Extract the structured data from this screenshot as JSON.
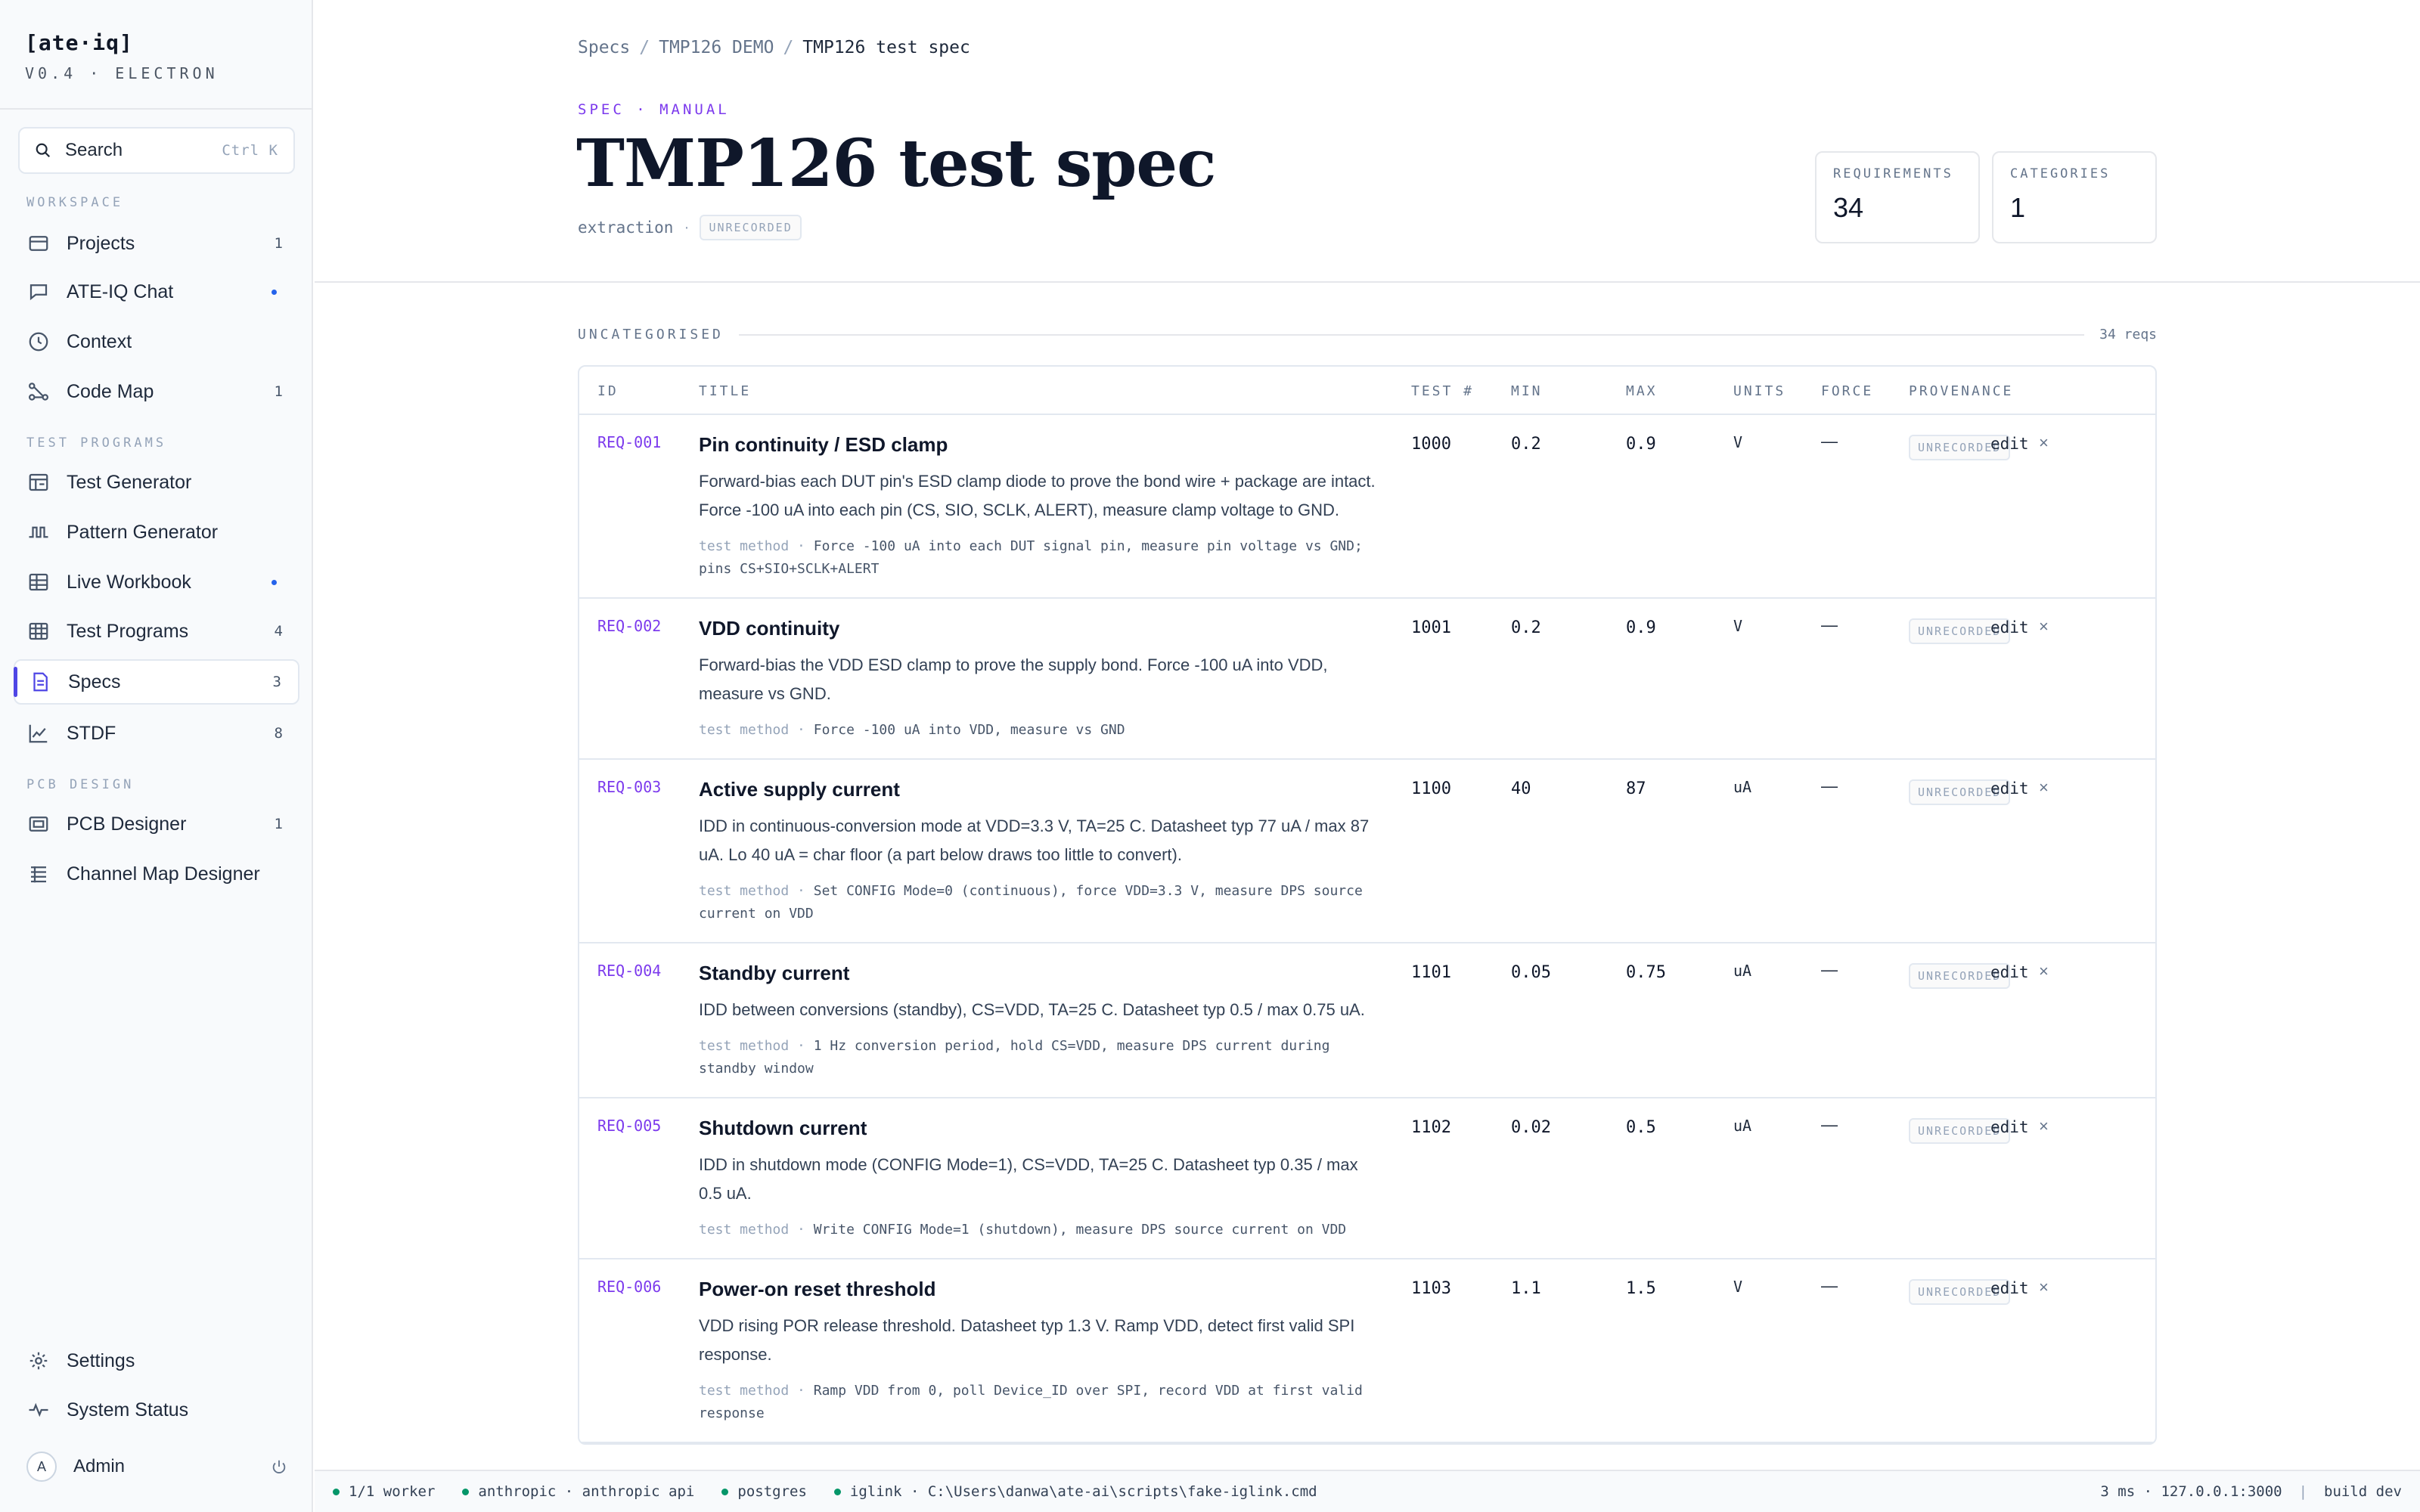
{
  "app": {
    "name": "[ate·iq]",
    "version": "V0.4 · ELECTRON"
  },
  "search": {
    "label": "Search",
    "shortcut": "Ctrl K"
  },
  "sidebar": {
    "sections": {
      "workspace": "WORKSPACE",
      "test_programs": "TEST PROGRAMS",
      "pcb_design": "PCB DESIGN"
    },
    "items": [
      {
        "label": "Projects",
        "badge": "1",
        "icon": "folder-icon"
      },
      {
        "label": "ATE-IQ Chat",
        "badge": "",
        "dot": true,
        "icon": "chat-icon"
      },
      {
        "label": "Context",
        "badge": "",
        "icon": "clock-icon"
      },
      {
        "label": "Code Map",
        "badge": "1",
        "icon": "graph-icon"
      },
      {
        "label": "Test Generator",
        "badge": "",
        "icon": "generator-icon"
      },
      {
        "label": "Pattern Generator",
        "badge": "",
        "icon": "waveform-icon"
      },
      {
        "label": "Live Workbook",
        "badge": "",
        "dot": true,
        "icon": "workbook-icon"
      },
      {
        "label": "Test Programs",
        "badge": "4",
        "icon": "grid-icon"
      },
      {
        "label": "Specs",
        "badge": "3",
        "icon": "document-icon",
        "active": true
      },
      {
        "label": "STDF",
        "badge": "8",
        "icon": "chart-icon"
      },
      {
        "label": "PCB Designer",
        "badge": "1",
        "icon": "board-icon"
      },
      {
        "label": "Channel Map Designer",
        "badge": "",
        "icon": "channels-icon"
      }
    ],
    "footer": [
      {
        "label": "Settings",
        "icon": "gear-icon"
      },
      {
        "label": "System Status",
        "icon": "pulse-icon"
      }
    ],
    "user": {
      "initial": "A",
      "name": "Admin"
    }
  },
  "breadcrumb": [
    "Specs",
    "TMP126 DEMO",
    "TMP126 test spec"
  ],
  "page": {
    "kicker": "SPEC · MANUAL",
    "title": "TMP126 test spec",
    "meta_label": "extraction",
    "meta_pill": "UNRECORDED"
  },
  "stats": [
    {
      "label": "REQUIREMENTS",
      "value": "34"
    },
    {
      "label": "CATEGORIES",
      "value": "1"
    }
  ],
  "group": {
    "name": "UNCATEGORISED",
    "count": "34 reqs"
  },
  "table": {
    "columns": {
      "id": "ID",
      "title": "TITLE",
      "test": "TEST #",
      "min": "MIN",
      "max": "MAX",
      "units": "UNITS",
      "force": "FORCE",
      "provenance": "PROVENANCE"
    },
    "edit_label": "edit",
    "close_glyph": "×",
    "method_key": "test method ·",
    "rows": [
      {
        "id": "REQ-001",
        "title": "Pin continuity / ESD clamp",
        "desc": "Forward-bias each DUT pin's ESD clamp diode to prove the bond wire + package are intact. Force -100 uA into each pin (CS, SIO, SCLK, ALERT), measure clamp voltage to GND.",
        "method": "Force -100 uA into each DUT signal pin, measure pin voltage vs GND; pins CS+SIO+SCLK+ALERT",
        "test": "1000",
        "min": "0.2",
        "max": "0.9",
        "units": "V",
        "force": "—",
        "provenance": "UNRECORDED"
      },
      {
        "id": "REQ-002",
        "title": "VDD continuity",
        "desc": "Forward-bias the VDD ESD clamp to prove the supply bond. Force -100 uA into VDD, measure vs GND.",
        "method": "Force -100 uA into VDD, measure vs GND",
        "test": "1001",
        "min": "0.2",
        "max": "0.9",
        "units": "V",
        "force": "—",
        "provenance": "UNRECORDED"
      },
      {
        "id": "REQ-003",
        "title": "Active supply current",
        "desc": "IDD in continuous-conversion mode at VDD=3.3 V, TA=25 C. Datasheet typ 77 uA / max 87 uA. Lo 40 uA = char floor (a part below draws too little to convert).",
        "method": "Set CONFIG Mode=0 (continuous), force VDD=3.3 V, measure DPS source current on VDD",
        "test": "1100",
        "min": "40",
        "max": "87",
        "units": "uA",
        "force": "—",
        "provenance": "UNRECORDED"
      },
      {
        "id": "REQ-004",
        "title": "Standby current",
        "desc": "IDD between conversions (standby), CS=VDD, TA=25 C. Datasheet typ 0.5 / max 0.75 uA.",
        "method": "1 Hz conversion period, hold CS=VDD, measure DPS current during standby window",
        "test": "1101",
        "min": "0.05",
        "max": "0.75",
        "units": "uA",
        "force": "—",
        "provenance": "UNRECORDED"
      },
      {
        "id": "REQ-005",
        "title": "Shutdown current",
        "desc": "IDD in shutdown mode (CONFIG Mode=1), CS=VDD, TA=25 C. Datasheet typ 0.35 / max 0.5 uA.",
        "method": "Write CONFIG Mode=1 (shutdown), measure DPS source current on VDD",
        "test": "1102",
        "min": "0.02",
        "max": "0.5",
        "units": "uA",
        "force": "—",
        "provenance": "UNRECORDED"
      },
      {
        "id": "REQ-006",
        "title": "Power-on reset threshold",
        "desc": "VDD rising POR release threshold. Datasheet typ 1.3 V. Ramp VDD, detect first valid SPI response.",
        "method": "Ramp VDD from 0, poll Device_ID over SPI, record VDD at first valid response",
        "test": "1103",
        "min": "1.1",
        "max": "1.5",
        "units": "V",
        "force": "—",
        "provenance": "UNRECORDED"
      }
    ]
  },
  "status": {
    "items": [
      "1/1 worker",
      "anthropic · anthropic api",
      "postgres",
      "iglink · C:\\Users\\danwa\\ate-ai\\scripts\\fake-iglink.cmd"
    ],
    "right": "3 ms · 127.0.0.1:3000",
    "build": "build dev",
    "divider": "|"
  },
  "colors": {
    "accent": "#7c3aed",
    "active_bar": "#4f46e5",
    "ok": "#059669",
    "dot": "#2563eb"
  }
}
